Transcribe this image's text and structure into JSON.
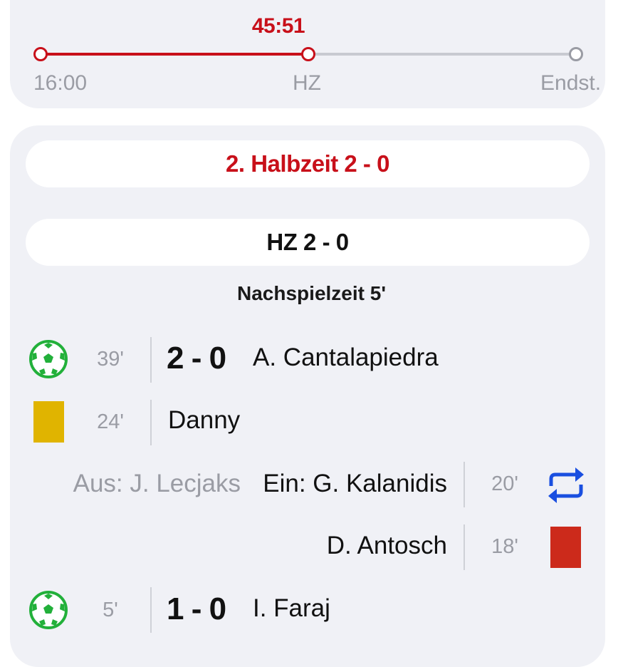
{
  "timeline": {
    "elapsed": "45:51",
    "kickoff": "16:00",
    "halftime": "HZ",
    "fulltime": "Endst.",
    "progress": 0.5
  },
  "ticker": {
    "second_half_header": "2. Halbzeit 2 - 0",
    "halftime_header": "HZ 2 - 0",
    "added_time": "Nachspielzeit 5'",
    "events": [
      {
        "icon": "soccer-ball-icon",
        "minute": "39'",
        "score": "2 - 0",
        "player": "A. Cantalapiedra"
      },
      {
        "icon": "yellow-card-icon",
        "minute": "24'",
        "player": "Danny"
      },
      {
        "icon": "substitution-icon",
        "minute": "20'",
        "out": "Aus: J. Lecjaks",
        "in": "Ein: G. Kalanidis"
      },
      {
        "icon": "red-card-icon",
        "minute": "18'",
        "player": "D. Antosch"
      },
      {
        "icon": "soccer-ball-icon",
        "minute": "5'",
        "score": "1 - 0",
        "player": "I. Faraj"
      }
    ]
  },
  "colors": {
    "accent": "#c8101a",
    "goal": "#22b03a",
    "yellow_card": "#e0b400",
    "red_card": "#cc2a1b",
    "substitution": "#1a4fe0",
    "card_bg": "#f0f1f6"
  }
}
